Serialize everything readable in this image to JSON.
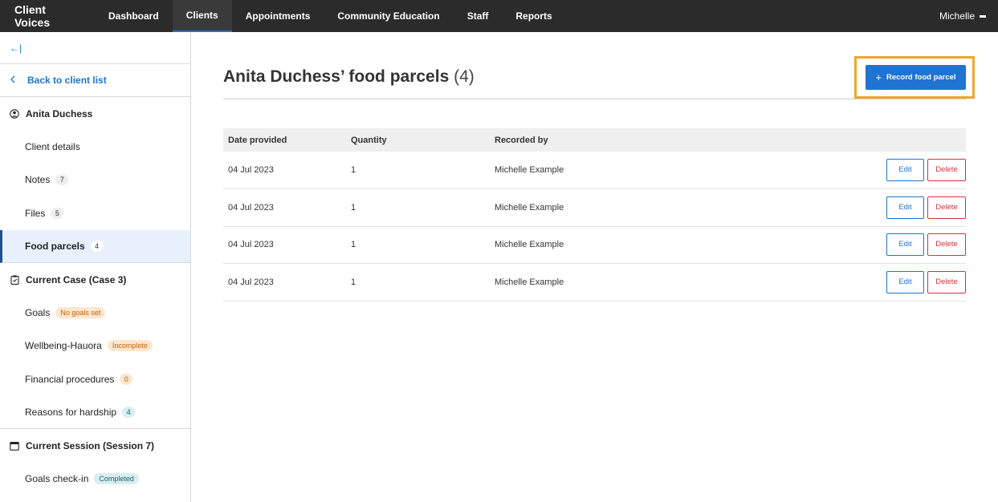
{
  "nav": {
    "brand": "Client Voices",
    "items": [
      {
        "label": "Dashboard"
      },
      {
        "label": "Clients"
      },
      {
        "label": "Appointments"
      },
      {
        "label": "Community Education"
      },
      {
        "label": "Staff"
      },
      {
        "label": "Reports"
      }
    ],
    "active": "Clients",
    "user": "Michelle"
  },
  "sidebar": {
    "collapse_glyph": "←|",
    "back_label": "Back to client list",
    "client": {
      "name": "Anita Duchess",
      "items": [
        {
          "label": "Client details"
        },
        {
          "label": "Notes",
          "count": "7"
        },
        {
          "label": "Files",
          "count": "5"
        },
        {
          "label": "Food parcels",
          "count": "4"
        }
      ]
    },
    "case": {
      "title": "Current Case (Case 3)",
      "items": [
        {
          "label": "Goals",
          "badge": "No goals set"
        },
        {
          "label": "Wellbeing-Hauora",
          "badge": "Incomplete"
        },
        {
          "label": "Financial procedures",
          "count": "0"
        },
        {
          "label": "Reasons for hardship",
          "count": "4"
        }
      ]
    },
    "session": {
      "title": "Current Session (Session 7)",
      "items": [
        {
          "label": "Goals check-in",
          "badge": "Completed"
        }
      ]
    }
  },
  "main": {
    "title": "Anita Duchess’ food parcels",
    "title_count": "(4)",
    "record_button": "Record food parcel",
    "table": {
      "headers": [
        "Date provided",
        "Quantity",
        "Recorded by"
      ],
      "rows": [
        {
          "date": "04 Jul 2023",
          "quantity": "1",
          "recorded_by": "Michelle Example"
        },
        {
          "date": "04 Jul 2023",
          "quantity": "1",
          "recorded_by": "Michelle Example"
        },
        {
          "date": "04 Jul 2023",
          "quantity": "1",
          "recorded_by": "Michelle Example"
        },
        {
          "date": "04 Jul 2023",
          "quantity": "1",
          "recorded_by": "Michelle Example"
        }
      ],
      "edit_label": "Edit",
      "delete_label": "Delete"
    }
  },
  "colors": {
    "nav_bg": "#2b2b2b",
    "accent": "#1f73d1",
    "danger": "#d0353f",
    "highlight": "#f0a62a"
  }
}
